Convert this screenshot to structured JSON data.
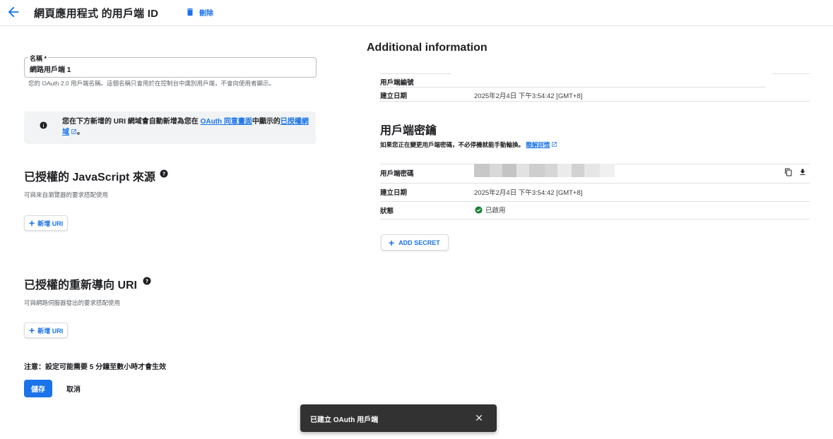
{
  "header": {
    "title": "網頁應用程式 的用戶端 ID",
    "delete_label": "刪除"
  },
  "name_field": {
    "label": "名稱 *",
    "value": "網路用戶端 1",
    "hint": "您的 OAuth 2.0 用戶端名稱。這個名稱只會用於在控制台中識別用戶端，不會向使用者顯示。"
  },
  "info_box": {
    "text_before": "您在下方新增的 URI 網域會自動新增為您在 ",
    "link1": "OAuth 同意畫面",
    "text_middle": "中顯示的",
    "link2": "已授權網域",
    "text_after": "。"
  },
  "js_origins": {
    "title": "已授權的 JavaScript 來源",
    "subtitle": "可與來自瀏覽器的要求搭配使用",
    "add_label": "新增 URI"
  },
  "redirect_uris": {
    "title": "已授權的重新導向 URI",
    "subtitle": "可與網路伺服器發出的要求搭配使用",
    "add_label": "新增 URI"
  },
  "footer": {
    "note": "注意：設定可能需要 5 分鐘至數小時才會生效",
    "save_label": "儲存",
    "cancel_label": "取消"
  },
  "additional_info": {
    "title": "Additional information",
    "client_id_label": "用戶端編號",
    "created_label": "建立日期",
    "created_value": "2025年2月4日 下午3:54:42 [GMT+8]"
  },
  "client_secret": {
    "title": "用戶端密鑰",
    "desc_text": "如果您正在變更用戶端密碼，不必停機就能手動輪換。",
    "desc_link": "瞭解詳情",
    "secret_label": "用戶端密碼",
    "created_label": "建立日期",
    "created_value": "2025年2月4日 下午3:54:42 [GMT+8]",
    "status_label": "狀態",
    "status_value": "已啟用",
    "add_secret_label": "ADD SECRET"
  },
  "snackbar": {
    "message": "已建立 OAuth 用戶端"
  },
  "colors": {
    "accent": "#1a73e8",
    "success": "#188038",
    "snackbar_bg": "#323232"
  },
  "icons": [
    "arrow-back-icon",
    "trash-icon",
    "info-icon",
    "help-icon",
    "plus-icon",
    "external-link-icon",
    "copy-icon",
    "download-icon",
    "check-circle-icon",
    "close-icon"
  ]
}
